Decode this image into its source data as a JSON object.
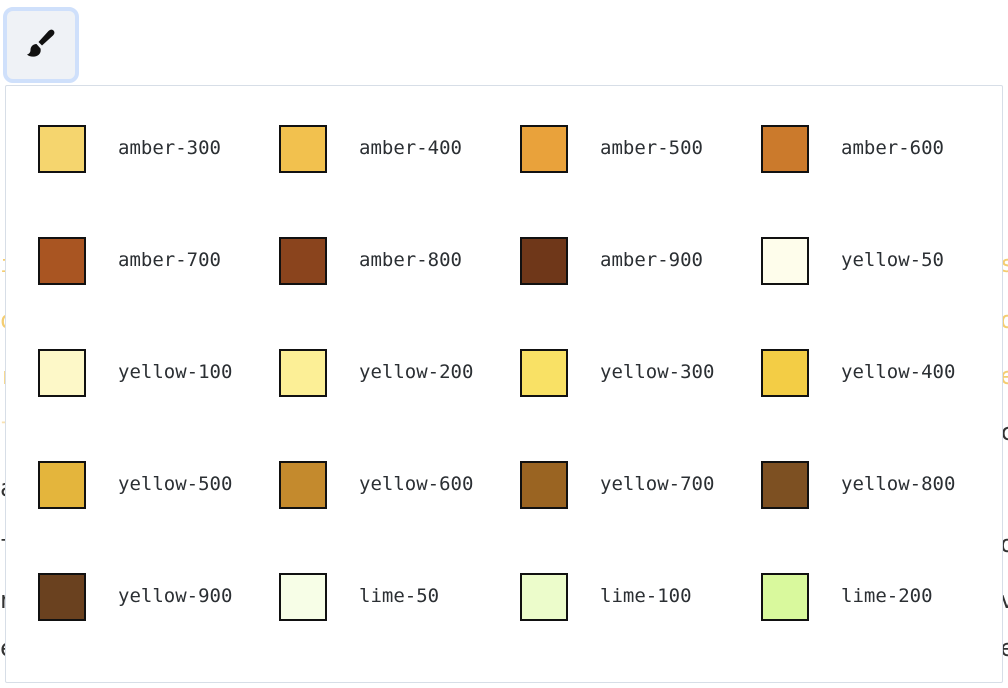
{
  "toolbar": {
    "brush_icon": "paintbrush-icon"
  },
  "palette": [
    {
      "name": "amber-300",
      "color": "#f5d56e"
    },
    {
      "name": "amber-400",
      "color": "#f2c14e"
    },
    {
      "name": "amber-500",
      "color": "#e9a23b"
    },
    {
      "name": "amber-600",
      "color": "#cb7a2c"
    },
    {
      "name": "amber-700",
      "color": "#a95522"
    },
    {
      "name": "amber-800",
      "color": "#8a441d"
    },
    {
      "name": "amber-900",
      "color": "#6f3719"
    },
    {
      "name": "yellow-50",
      "color": "#fefdeb"
    },
    {
      "name": "yellow-100",
      "color": "#fdf8c8"
    },
    {
      "name": "yellow-200",
      "color": "#fcef96"
    },
    {
      "name": "yellow-300",
      "color": "#f9e165"
    },
    {
      "name": "yellow-400",
      "color": "#f3cd45"
    },
    {
      "name": "yellow-500",
      "color": "#e4b53c"
    },
    {
      "name": "yellow-600",
      "color": "#c48a2d"
    },
    {
      "name": "yellow-700",
      "color": "#9a6422"
    },
    {
      "name": "yellow-800",
      "color": "#7d5022"
    },
    {
      "name": "yellow-900",
      "color": "#6a411f"
    },
    {
      "name": "lime-50",
      "color": "#f7fee7"
    },
    {
      "name": "lime-100",
      "color": "#ecfccb"
    },
    {
      "name": "lime-200",
      "color": "#d9f99d"
    }
  ]
}
